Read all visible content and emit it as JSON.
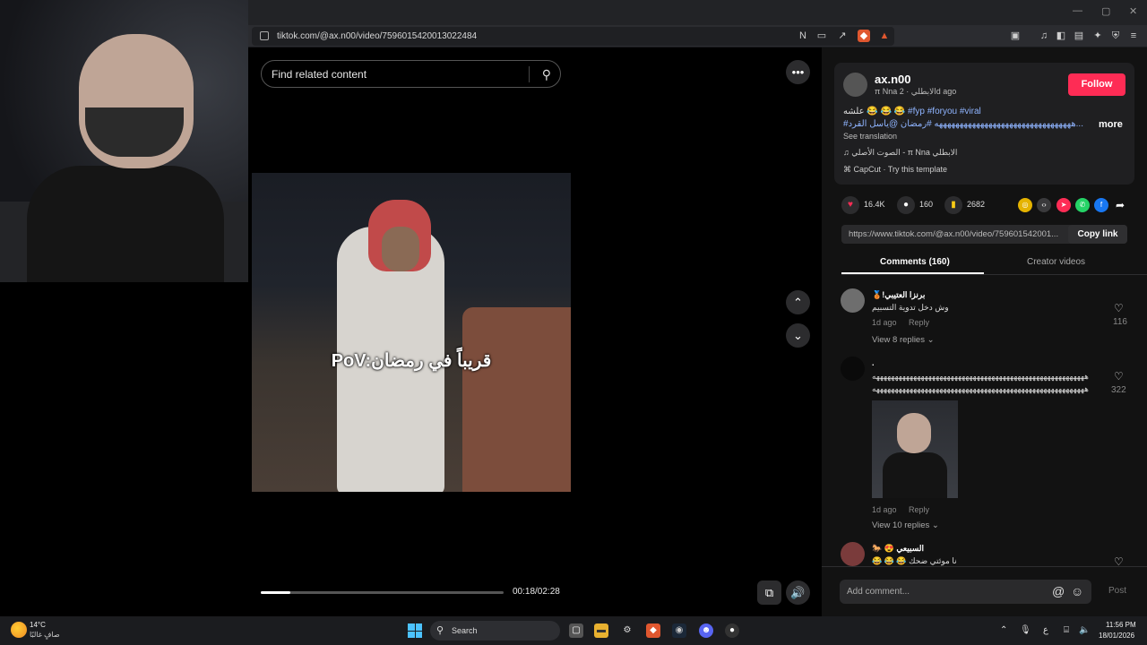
{
  "browser": {
    "url": "tiktok.com/@ax.n00/video/7596015420013022484",
    "window_controls": [
      "—",
      "▢",
      "✕"
    ]
  },
  "video": {
    "search_placeholder": "Find related content",
    "caption": "PoV:قريباً في رمضان",
    "time": "00:18/02:28",
    "progress_fraction": 0.12
  },
  "post": {
    "username": "ax.n00",
    "subline": "π Nna الابطلي · 2d ago",
    "follow_label": "Follow",
    "desc_line1_prefix": "علشه 😂 😂 😂",
    "desc_line1_tags": "#fyp #foryou #viral",
    "desc_line2": "#هههههههههههههههههههههههههههههههههه #رمضان @ياسل القرد...",
    "more_label": "more",
    "see_translation": "See translation",
    "music": "الصوت الأصلي - π Nna الابطلي",
    "capcut": "CapCut · Try this template",
    "likes": "16.4K",
    "comments": "160",
    "saves": "2682",
    "link": "https://www.tiktok.com/@ax.n00/video/759601542001...",
    "copy_label": "Copy link",
    "tab_comments": "Comments (160)",
    "tab_creator": "Creator videos"
  },
  "comments": [
    {
      "name": "🥉!برنزا العتيبي",
      "text": "وش دخل تدوية التسبيم",
      "meta": "1d ago",
      "reply": "Reply",
      "view_replies": "View 8 replies",
      "likes": "116"
    },
    {
      "name": ".",
      "text": "هههههههههههههههههههههههههههههههههههههههههههههههههههههههههه",
      "text2": "هههههههههههههههههههههههههههههههههههههههههههههههههههههههههه",
      "meta": "1d ago",
      "reply": "Reply",
      "view_replies": "View 10 replies",
      "likes": "322"
    },
    {
      "name": "🐎 😍 السبيعي",
      "text": "😂 😂 😂 نا موئتي ضحك"
    }
  ],
  "composer": {
    "placeholder": "Add comment...",
    "post_label": "Post"
  },
  "taskbar": {
    "temp": "14°C",
    "weather": "صافٍ غالبًا",
    "search": "Search",
    "lang": "ع",
    "time": "11:56 PM",
    "date": "18/01/2026"
  }
}
